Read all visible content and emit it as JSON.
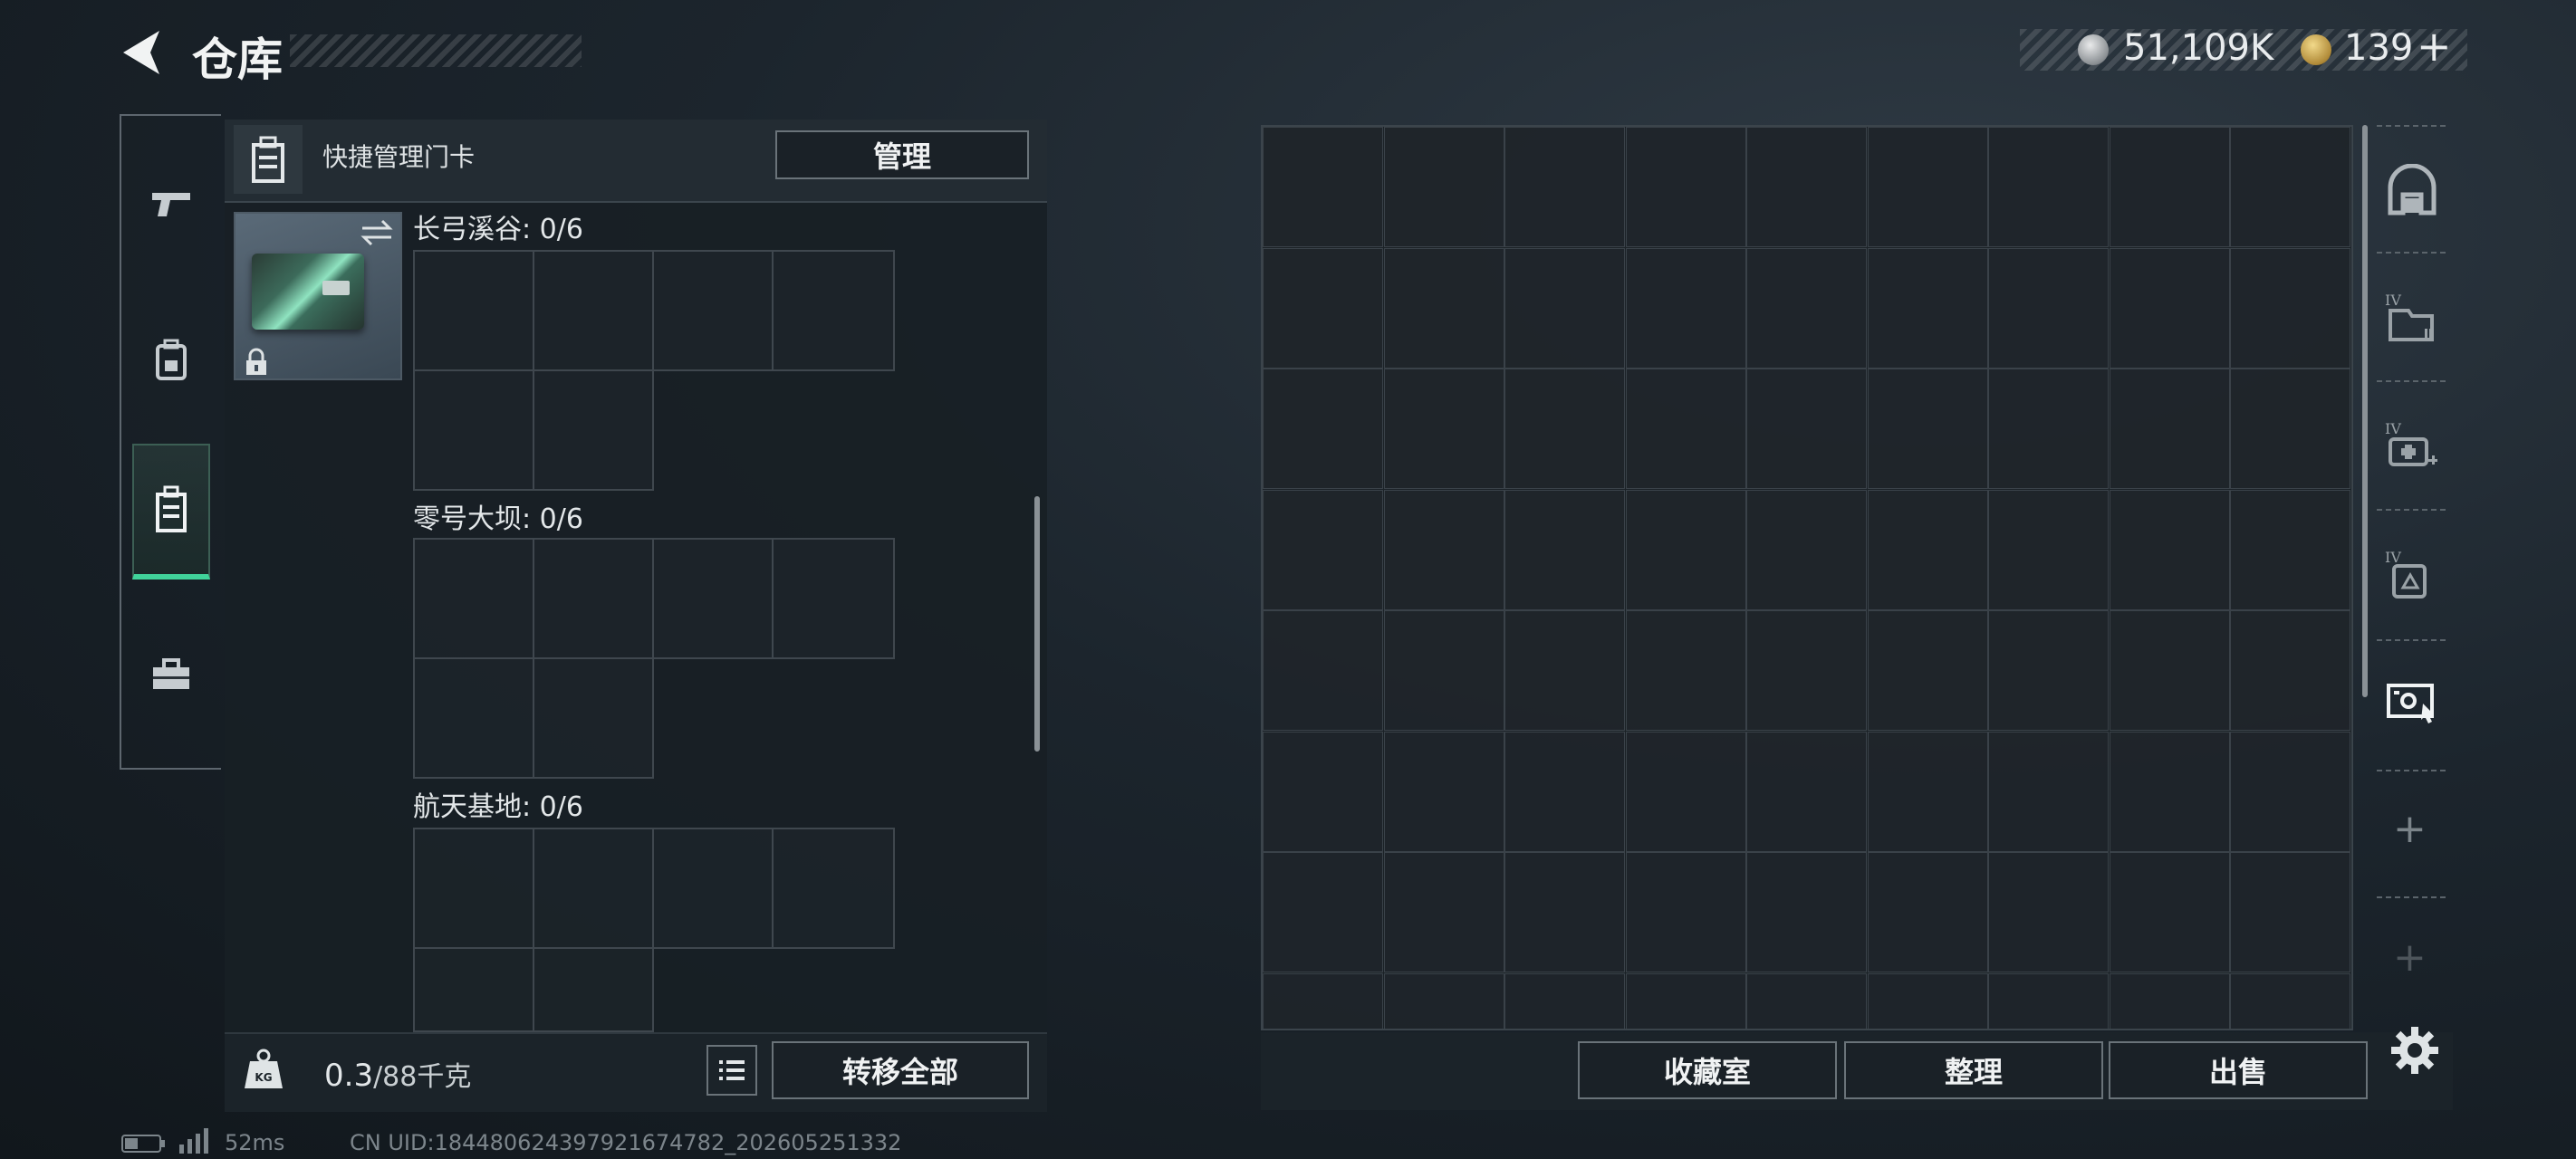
{
  "header": {
    "title": "仓库",
    "currency1_value": "51,109K",
    "currency2_value": "139",
    "currency2_plus": "+"
  },
  "quick": {
    "label": "快捷管理门卡",
    "manage_label": "管理"
  },
  "sections": [
    {
      "label": "长弓溪谷: 0/6"
    },
    {
      "label": "零号大坝: 0/6"
    },
    {
      "label": "航天基地: 0/6"
    }
  ],
  "footer_left": {
    "weight_value": "0.3",
    "weight_capacity": "/88千克",
    "transfer_label": "转移全部"
  },
  "storage": {
    "collection_label": "收藏室",
    "organize_label": "整理",
    "sell_label": "出售"
  },
  "status": {
    "latency": "52ms",
    "uid": "CN UID:18448062439792167478​2_202605251332"
  },
  "right_tabs": {
    "numeral_label": "IV"
  },
  "icons": [
    "back-arrow-icon",
    "pistol-icon",
    "backpack-icon",
    "keycard-case-icon",
    "toolbox-icon",
    "kg-weight-icon",
    "list-icon",
    "swap-icon",
    "lock-icon",
    "gear-icon",
    "plus-icon"
  ]
}
